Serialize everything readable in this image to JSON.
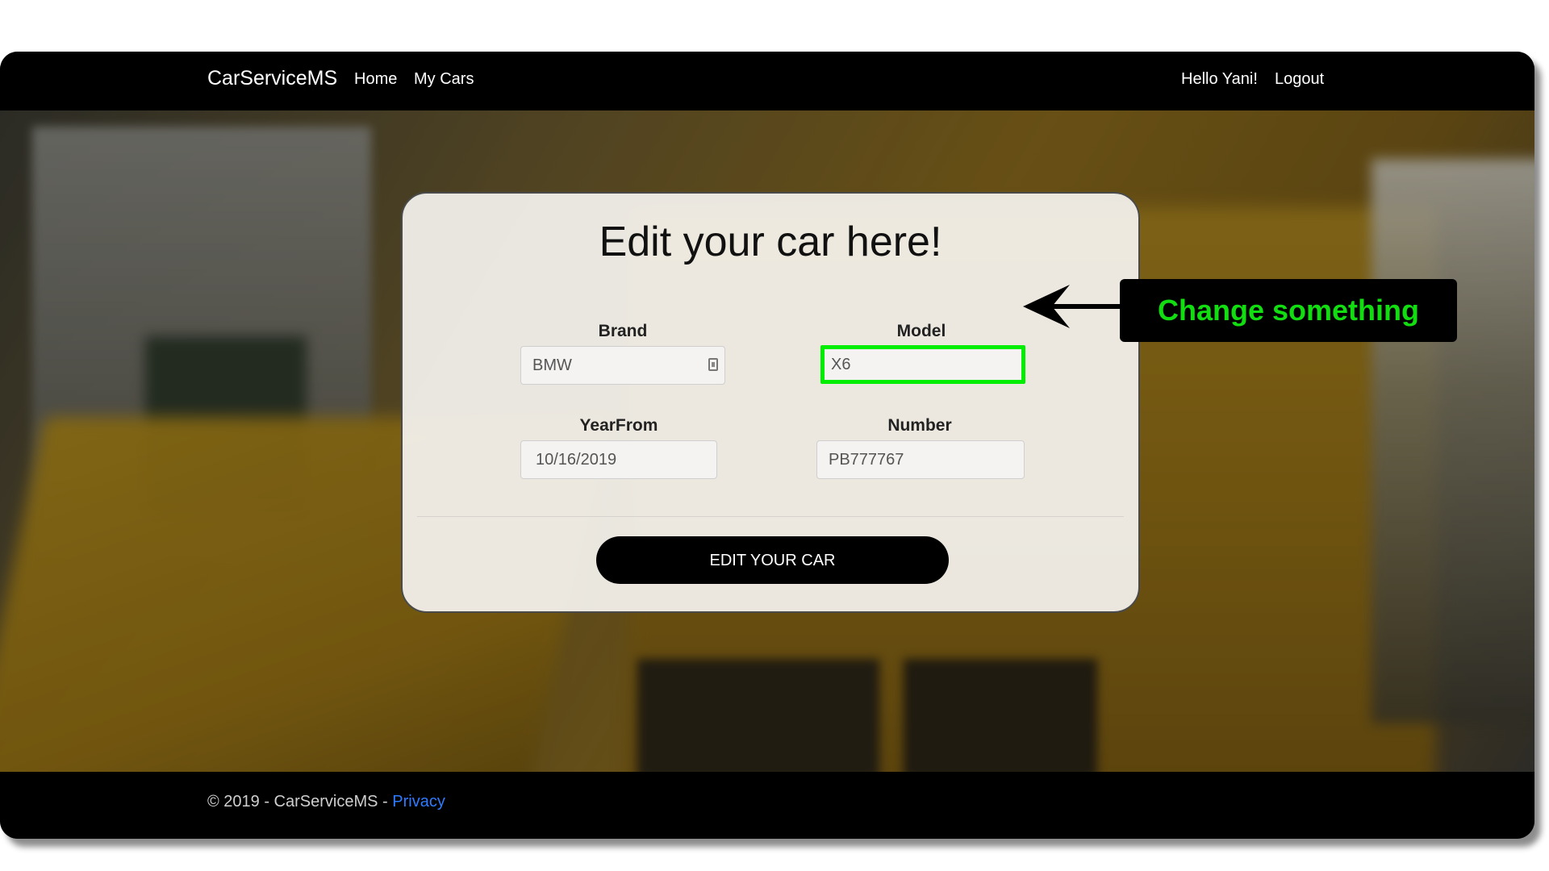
{
  "navbar": {
    "brand": "CarServiceMS",
    "links": [
      {
        "label": "Home"
      },
      {
        "label": "My Cars"
      }
    ],
    "greeting": "Hello Yani!",
    "logout": "Logout"
  },
  "form": {
    "title": "Edit your car here!",
    "fields": {
      "brand": {
        "label": "Brand",
        "value": "BMW"
      },
      "model": {
        "label": "Model",
        "value": "X6"
      },
      "year_from": {
        "label": "YearFrom",
        "value": "10/16/2019"
      },
      "number": {
        "label": "Number",
        "value": "PB777767"
      }
    },
    "submit_label": "EDIT YOUR CAR"
  },
  "annotation": {
    "callout_text": "Change something",
    "highlight_color": "#00ee00",
    "callout_text_color": "#11dd11"
  },
  "footer": {
    "copyright": "© 2019 - CarServiceMS - ",
    "privacy_link": "Privacy"
  },
  "colors": {
    "navbar_bg": "#000000",
    "button_bg": "#000000",
    "link_blue": "#2f7bff"
  }
}
